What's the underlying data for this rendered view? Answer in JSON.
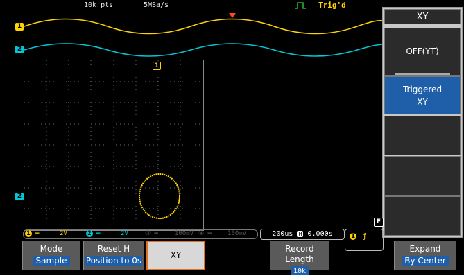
{
  "status": {
    "record_points": "10k pts",
    "sample_rate": "5MSa/s",
    "trigger_state": "Trig'd"
  },
  "channels": {
    "ch1_label": "1",
    "ch2_label": "2",
    "ch1_color": "#ffd400",
    "ch2_color": "#00d0e0"
  },
  "xy_plot": {
    "marker_label": "1"
  },
  "menu": {
    "title": "XY",
    "options": [
      {
        "label": "OFF(YT)",
        "selected": false
      },
      {
        "label_line1": "Triggered",
        "label_line2": "XY",
        "selected": true
      }
    ]
  },
  "infobar": {
    "ch1_scale": "2V",
    "ch2_scale": "2V",
    "ch3_scale": "100mV",
    "ch4_scale": "100mV",
    "timebase": "200us",
    "horizontal_position": "0.000s",
    "f_label": "F"
  },
  "softkeys": [
    {
      "line1": "Mode",
      "line2": "Sample"
    },
    {
      "line1": "Reset H",
      "line2": "Position to 0s"
    },
    {
      "line1": "XY"
    },
    {
      "line1": "Record Length",
      "line2": "10k"
    },
    {
      "line1": "Expand",
      "line2": "By Center"
    }
  ],
  "accent_color": "#1f5ea8",
  "active_outline_color": "#e07020"
}
